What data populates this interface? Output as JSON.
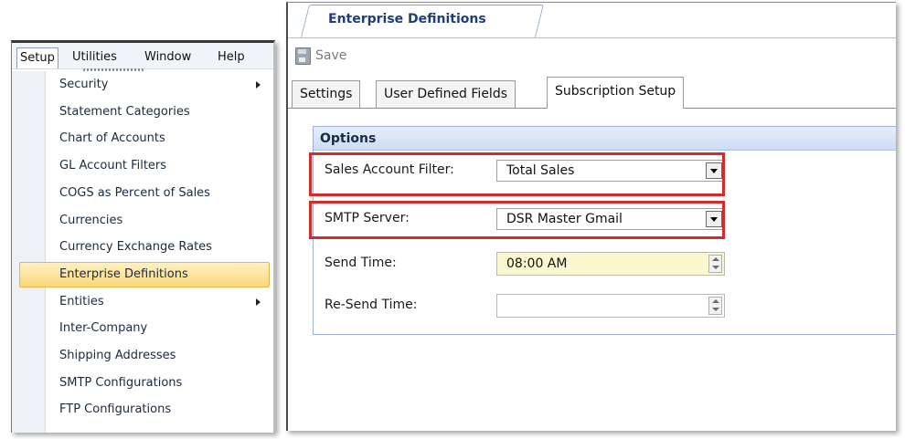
{
  "menubar": {
    "items": [
      {
        "label": "Setup",
        "active": true
      },
      {
        "label": "Utilities",
        "active": false
      },
      {
        "label": "Window",
        "active": false
      },
      {
        "label": "Help",
        "active": false
      }
    ]
  },
  "setup_menu": {
    "items": [
      {
        "label": "Security",
        "submenu": true
      },
      {
        "label": "Statement Categories",
        "submenu": false
      },
      {
        "label": "Chart of Accounts",
        "submenu": false
      },
      {
        "label": "GL Account Filters",
        "submenu": false
      },
      {
        "label": "COGS as Percent of Sales",
        "submenu": false
      },
      {
        "label": "Currencies",
        "submenu": false
      },
      {
        "label": "Currency Exchange Rates",
        "submenu": false
      },
      {
        "label": "Enterprise Definitions",
        "submenu": false,
        "selected": true
      },
      {
        "label": "Entities",
        "submenu": true
      },
      {
        "label": "Inter-Company",
        "submenu": false
      },
      {
        "label": "Shipping Addresses",
        "submenu": false
      },
      {
        "label": "SMTP Configurations",
        "submenu": false
      },
      {
        "label": "FTP Configurations",
        "submenu": false
      }
    ]
  },
  "window": {
    "doc_tab_title": "Enterprise Definitions",
    "toolbar": {
      "save_label": "Save",
      "save_icon": "save-icon"
    },
    "tabs": [
      {
        "label": "Settings",
        "active": false
      },
      {
        "label": "User Defined Fields",
        "active": false
      },
      {
        "label": "Subscription Setup",
        "active": true
      }
    ],
    "options": {
      "header": "Options",
      "sales_account_filter": {
        "label": "Sales Account Filter:",
        "value": "Total Sales"
      },
      "smtp_server": {
        "label": "SMTP Server:",
        "value": "DSR Master Gmail"
      },
      "send_time": {
        "label": "Send Time:",
        "value": "08:00 AM"
      },
      "resend_time": {
        "label": "Re-Send Time:",
        "value": ""
      }
    }
  },
  "colors": {
    "highlight_border": "#d32a2a",
    "selected_menu_item": "#fbd87a",
    "options_header": "#cddcf3",
    "send_time_fill": "#fbf8cf"
  }
}
